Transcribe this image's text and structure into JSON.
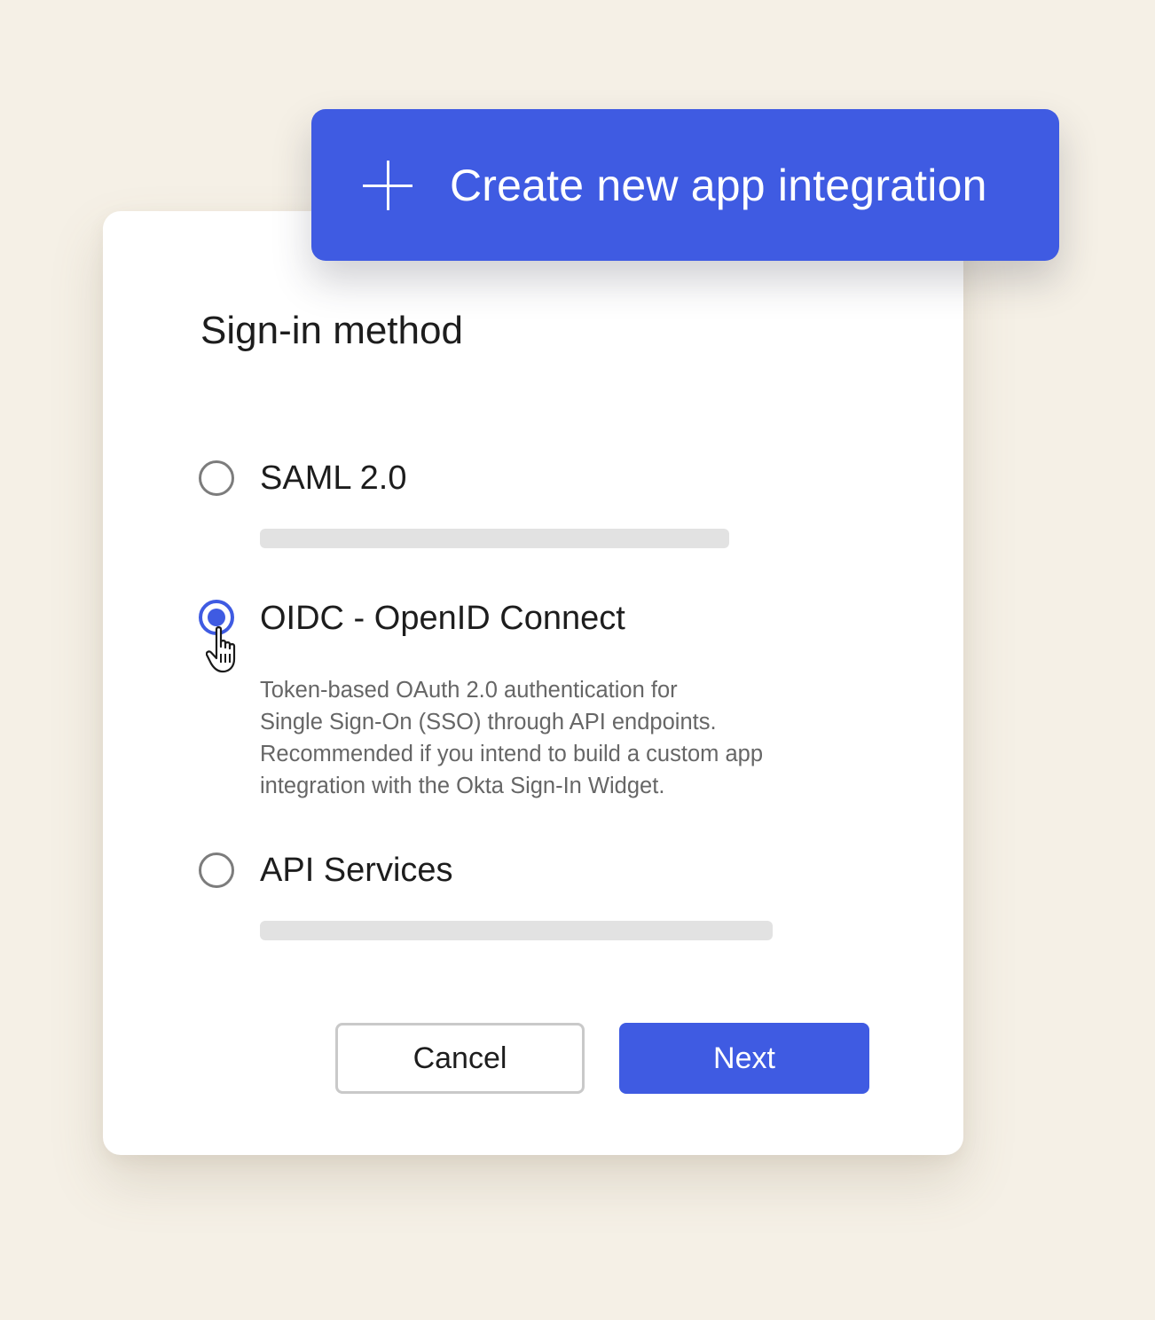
{
  "header": {
    "create_label": "Create new app integration"
  },
  "form": {
    "title": "Sign-in method",
    "options": [
      {
        "label": "SAML 2.0",
        "selected": false
      },
      {
        "label": "OIDC - OpenID Connect",
        "selected": true,
        "description_lines": [
          "Token-based OAuth 2.0 authentication for",
          "Single Sign-On (SSO) through API endpoints.",
          "Recommended if you intend to build a custom app",
          "integration with the Okta Sign-In Widget."
        ]
      },
      {
        "label": "API Services",
        "selected": false
      }
    ]
  },
  "actions": {
    "cancel_label": "Cancel",
    "next_label": "Next"
  },
  "colors": {
    "accent": "#3f5be2",
    "background": "#f5f0e6",
    "card": "#ffffff"
  }
}
